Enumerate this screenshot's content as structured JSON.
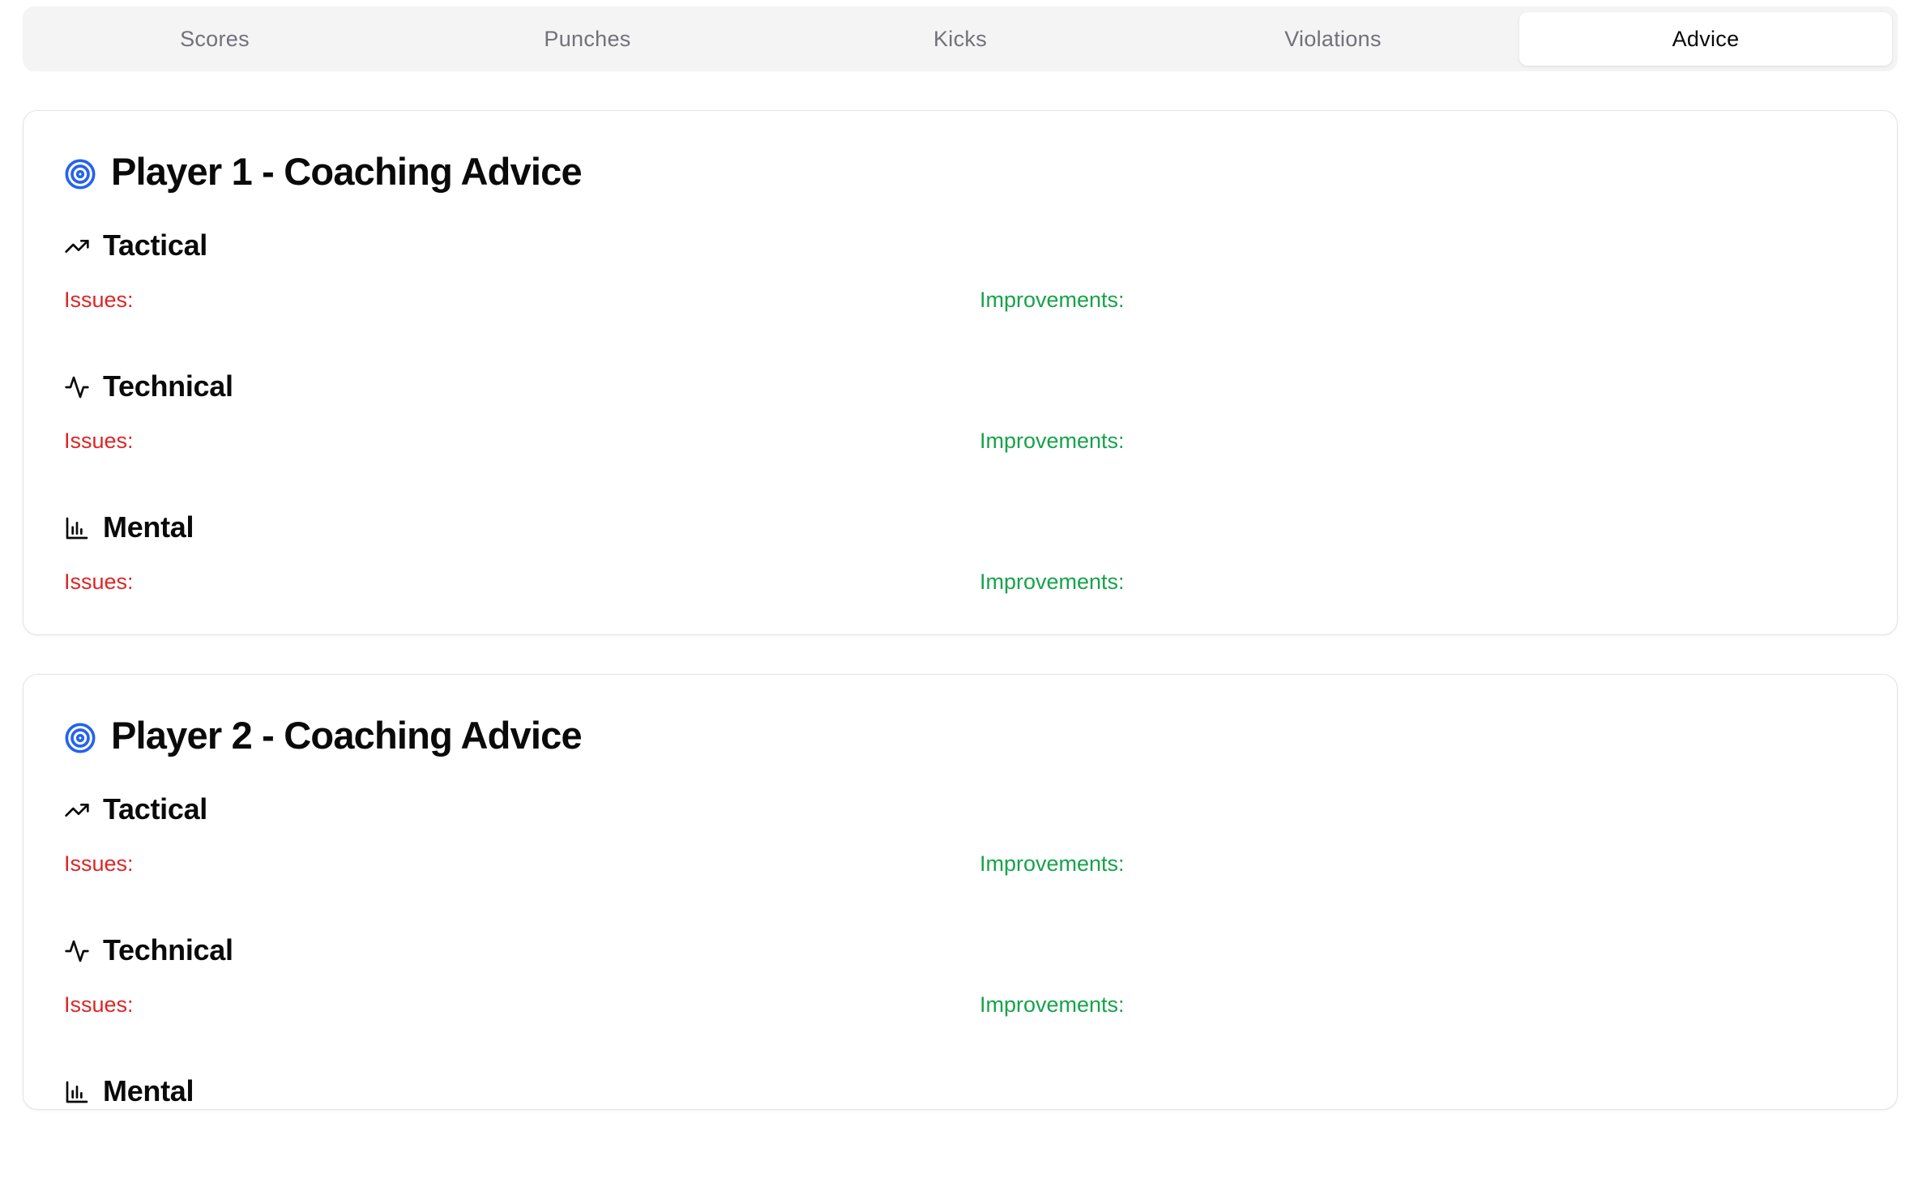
{
  "tabs": [
    {
      "label": "Scores",
      "active": false
    },
    {
      "label": "Punches",
      "active": false
    },
    {
      "label": "Kicks",
      "active": false
    },
    {
      "label": "Violations",
      "active": false
    },
    {
      "label": "Advice",
      "active": true
    }
  ],
  "colors": {
    "accent_icon": "#2563eb",
    "issues": "#dc2626",
    "improvements": "#16a34a"
  },
  "players": [
    {
      "title": "Player 1 - Coaching Advice",
      "title_icon": "target-icon",
      "sections": [
        {
          "name": "Tactical",
          "icon": "trending-up-icon",
          "issues_label": "Issues:",
          "improvements_label": "Improvements:"
        },
        {
          "name": "Technical",
          "icon": "activity-icon",
          "issues_label": "Issues:",
          "improvements_label": "Improvements:"
        },
        {
          "name": "Mental",
          "icon": "bar-chart-icon",
          "issues_label": "Issues:",
          "improvements_label": "Improvements:"
        }
      ]
    },
    {
      "title": "Player 2 - Coaching Advice",
      "title_icon": "target-icon",
      "sections": [
        {
          "name": "Tactical",
          "icon": "trending-up-icon",
          "issues_label": "Issues:",
          "improvements_label": "Improvements:"
        },
        {
          "name": "Technical",
          "icon": "activity-icon",
          "issues_label": "Issues:",
          "improvements_label": "Improvements:"
        },
        {
          "name": "Mental",
          "icon": "bar-chart-icon",
          "issues_label": "",
          "improvements_label": ""
        }
      ]
    }
  ]
}
